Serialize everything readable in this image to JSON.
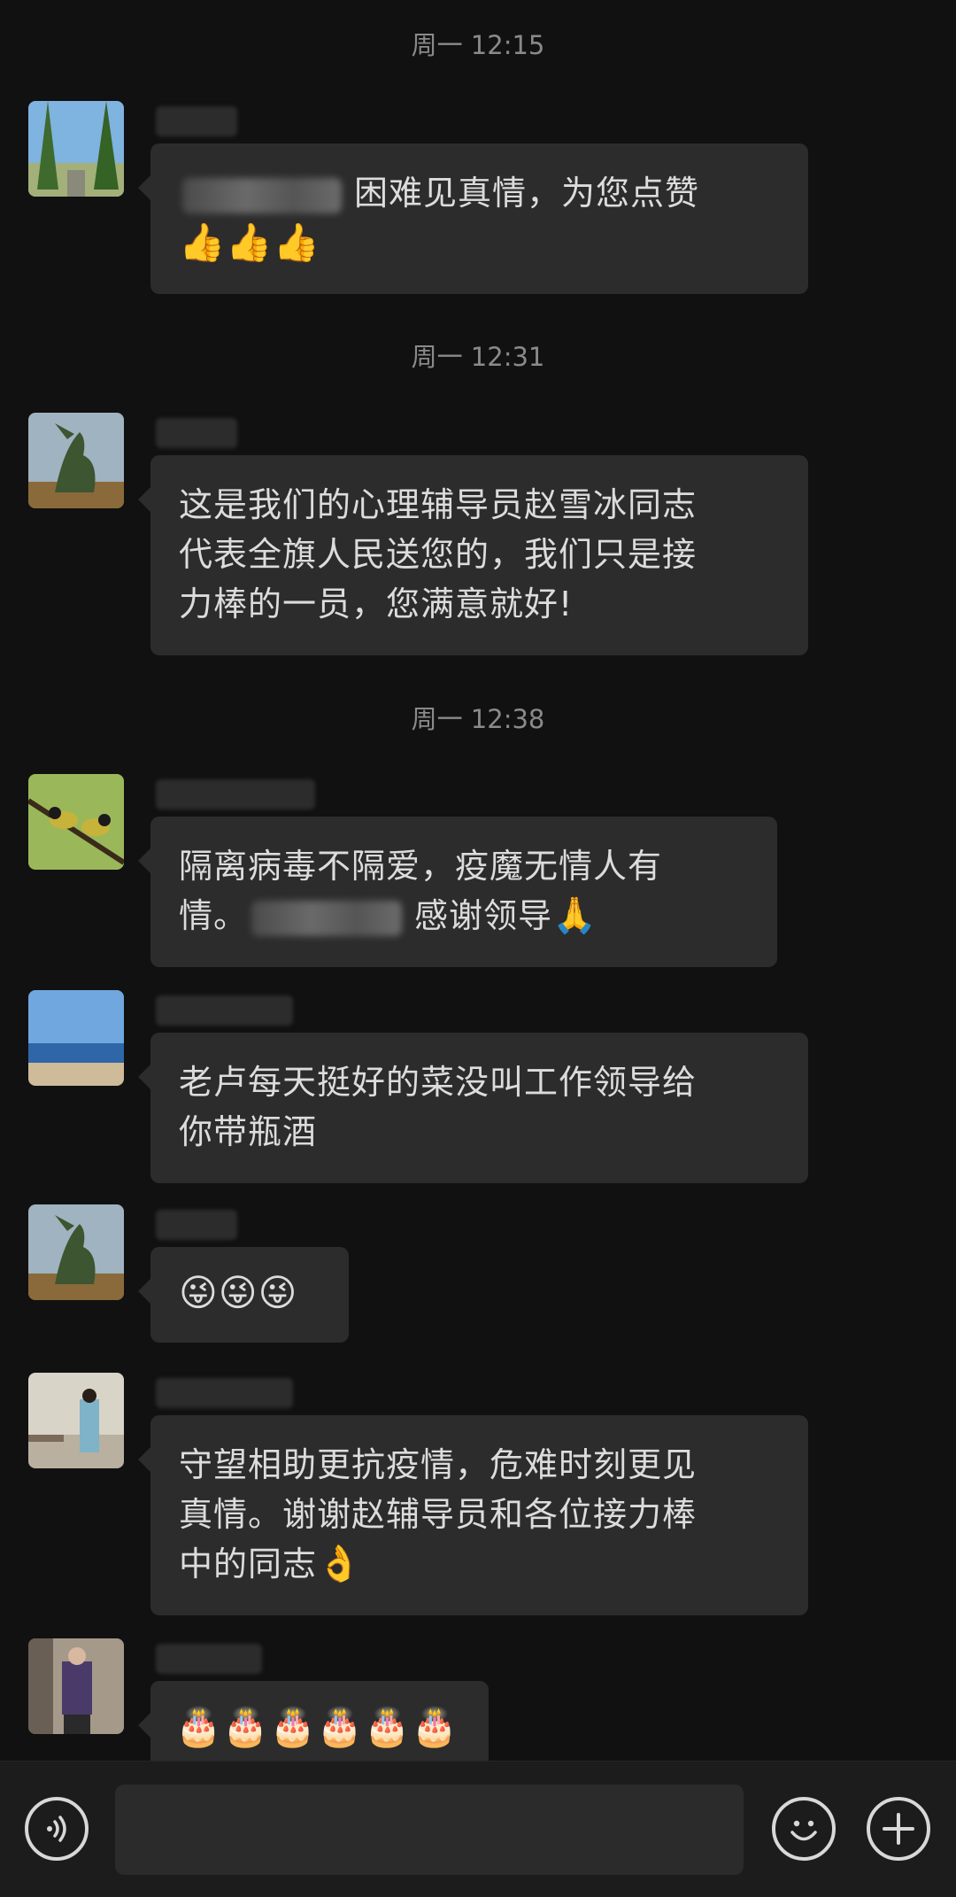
{
  "timestamps": [
    "周一 12:15",
    "周一 12:31",
    "周一 12:38"
  ],
  "messages": [
    {
      "avatar": "avatar-trees",
      "segments": [
        "困难见真情，为您点赞"
      ],
      "emoji": "👍👍👍"
    },
    {
      "avatar": "avatar-statue",
      "text": [
        "这是我们的心理辅导员赵雪冰同志",
        "代表全旗人民送您的，我们只是接",
        "力棒的一员，您满意就好!"
      ]
    },
    {
      "avatar": "avatar-birds",
      "line1": "隔离病毒不隔爱，疫魔无情人有",
      "line2a": "情。",
      "line2b": "感谢领导",
      "emoji": "🙏"
    },
    {
      "avatar": "avatar-beach",
      "text": [
        "老卢每天挺好的菜没叫工作领导给",
        "你带瓶酒"
      ]
    },
    {
      "avatar": "avatar-statue",
      "emoji": "😜😜😜"
    },
    {
      "avatar": "avatar-woman",
      "text": [
        "守望相助更抗疫情，危难时刻更见",
        "真情。谢谢赵辅导员和各位接力棒"
      ],
      "line3": "中的同志",
      "emoji": "👌"
    },
    {
      "avatar": "avatar-family",
      "emoji": "🎂🎂🎂🎂🎂🎂"
    }
  ],
  "input": {
    "placeholder": ""
  },
  "icons": {
    "voice": "voice-icon",
    "emoji": "emoji-icon",
    "plus": "plus-icon"
  }
}
